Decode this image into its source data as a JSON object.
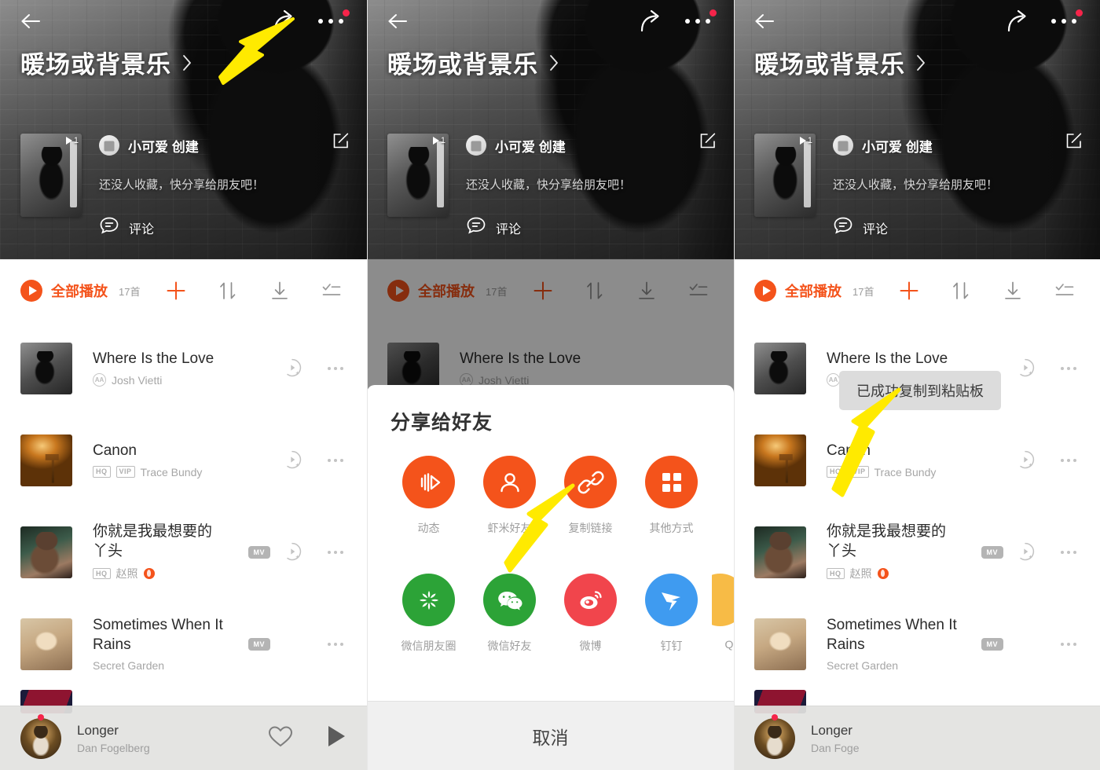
{
  "hero": {
    "title": "暖场或背景乐",
    "creator": "小可爱 创建",
    "note": "还没人收藏，快分享给朋友吧！",
    "comment_label": "评论",
    "play_count_badge": "1",
    "icons": {
      "back": "back-arrow-icon",
      "share": "share-icon",
      "more": "more-options-icon",
      "edit": "edit-icon",
      "chevron": "chevron-right-icon"
    }
  },
  "toolbar": {
    "play_all": "全部播放",
    "count": "17首",
    "icons": [
      "add-icon",
      "sort-icon",
      "download-icon",
      "multiselect-icon"
    ]
  },
  "songs": [
    {
      "title": "Where Is the Love",
      "title2": "",
      "artist": "Josh Vietti",
      "badges": [],
      "aa": true,
      "mv": false,
      "hot": false,
      "has_play": true,
      "art": "a1"
    },
    {
      "title": "Canon",
      "title2": "",
      "artist": "Trace Bundy",
      "badges": [
        "HQ",
        "VIP"
      ],
      "aa": false,
      "mv": false,
      "hot": false,
      "has_play": true,
      "art": "a2"
    },
    {
      "title": "你就是我最想要的",
      "title2": "丫头",
      "artist": "赵照",
      "badges": [
        "HQ"
      ],
      "aa": false,
      "mv": true,
      "hot": true,
      "has_play": true,
      "art": "a3"
    },
    {
      "title": "Sometimes When It",
      "title2": "Rains",
      "artist": "Secret Garden",
      "badges": [],
      "aa": false,
      "mv": true,
      "hot": false,
      "has_play": false,
      "art": "a4"
    }
  ],
  "player": {
    "title": "Longer",
    "artist": "Dan Fogelberg",
    "artist_clipped": "Dan Foge",
    "icons": [
      "heart-icon",
      "play-icon"
    ]
  },
  "share_sheet": {
    "title": "分享给好友",
    "cancel": "取消",
    "row1": [
      {
        "label": "动态",
        "icon": "dynamic-icon",
        "color": "#f4531b"
      },
      {
        "label": "虾米好友",
        "icon": "friend-icon",
        "color": "#f4531b"
      },
      {
        "label": "复制链接",
        "icon": "link-icon",
        "color": "#f4531b"
      },
      {
        "label": "其他方式",
        "icon": "grid-icon",
        "color": "#f4531b"
      }
    ],
    "row2": [
      {
        "label": "微信朋友圈",
        "icon": "wechat-moments-icon",
        "color": "#2ca337"
      },
      {
        "label": "微信好友",
        "icon": "wechat-icon",
        "color": "#2ca337"
      },
      {
        "label": "微博",
        "icon": "weibo-icon",
        "color": "#f1454c"
      },
      {
        "label": "钉钉",
        "icon": "dingtalk-icon",
        "color": "#3f9bf0"
      },
      {
        "label": "Q",
        "icon": "qq-icon",
        "color": "#f7bb46"
      }
    ]
  },
  "toast": {
    "message": "已成功复制到粘贴板"
  },
  "colors": {
    "accent": "#f4531b",
    "toast_bg": "#dcdcdc",
    "player_bg": "#e2e2e0"
  }
}
